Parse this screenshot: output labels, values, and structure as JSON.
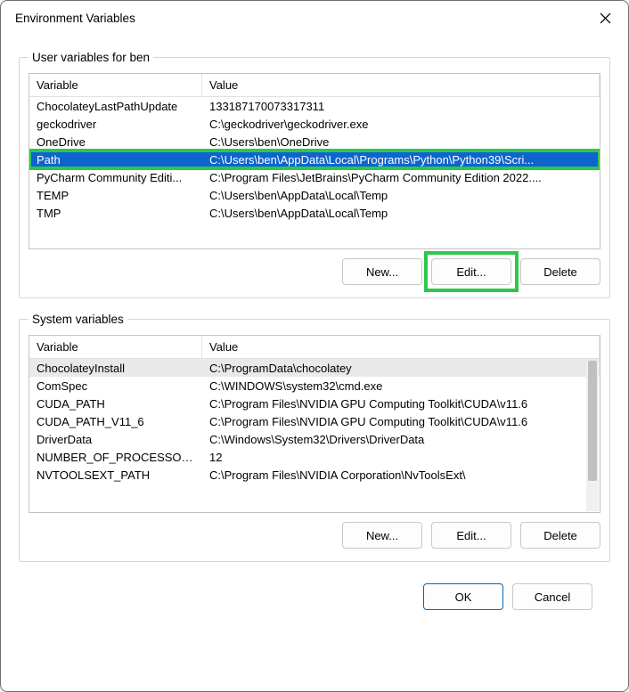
{
  "window": {
    "title": "Environment Variables"
  },
  "userGroup": {
    "legend": "User variables for ben",
    "columns": {
      "var": "Variable",
      "val": "Value"
    },
    "rows": [
      {
        "var": "ChocolateyLastPathUpdate",
        "val": "133187170073317311"
      },
      {
        "var": "geckodriver",
        "val": "C:\\geckodriver\\geckodriver.exe"
      },
      {
        "var": "OneDrive",
        "val": "C:\\Users\\ben\\OneDrive"
      },
      {
        "var": "Path",
        "val": "C:\\Users\\ben\\AppData\\Local\\Programs\\Python\\Python39\\Scri..."
      },
      {
        "var": "PyCharm Community Editi...",
        "val": "C:\\Program Files\\JetBrains\\PyCharm Community Edition 2022...."
      },
      {
        "var": "TEMP",
        "val": "C:\\Users\\ben\\AppData\\Local\\Temp"
      },
      {
        "var": "TMP",
        "val": "C:\\Users\\ben\\AppData\\Local\\Temp"
      }
    ],
    "buttons": {
      "new": "New...",
      "edit": "Edit...",
      "delete": "Delete"
    }
  },
  "sysGroup": {
    "legend": "System variables",
    "columns": {
      "var": "Variable",
      "val": "Value"
    },
    "rows": [
      {
        "var": "ChocolateyInstall",
        "val": "C:\\ProgramData\\chocolatey"
      },
      {
        "var": "ComSpec",
        "val": "C:\\WINDOWS\\system32\\cmd.exe"
      },
      {
        "var": "CUDA_PATH",
        "val": "C:\\Program Files\\NVIDIA GPU Computing Toolkit\\CUDA\\v11.6"
      },
      {
        "var": "CUDA_PATH_V11_6",
        "val": "C:\\Program Files\\NVIDIA GPU Computing Toolkit\\CUDA\\v11.6"
      },
      {
        "var": "DriverData",
        "val": "C:\\Windows\\System32\\Drivers\\DriverData"
      },
      {
        "var": "NUMBER_OF_PROCESSORS",
        "val": "12"
      },
      {
        "var": "NVTOOLSEXT_PATH",
        "val": "C:\\Program Files\\NVIDIA Corporation\\NvToolsExt\\"
      }
    ],
    "buttons": {
      "new": "New...",
      "edit": "Edit...",
      "delete": "Delete"
    }
  },
  "dialogButtons": {
    "ok": "OK",
    "cancel": "Cancel"
  }
}
